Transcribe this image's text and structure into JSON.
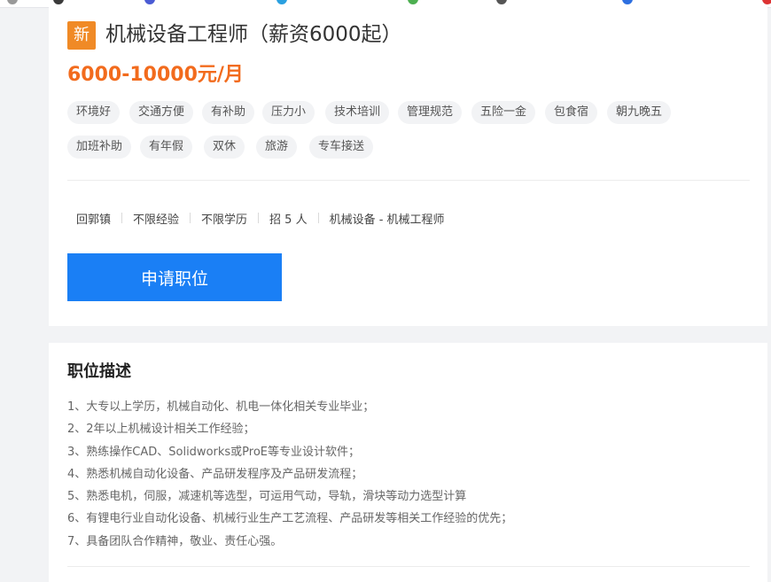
{
  "job": {
    "badge": "新",
    "title": "机械设备工程师（薪资6000起）",
    "salary": "6000-10000元/月",
    "tags_row1": [
      "环境好",
      "交通方便",
      "有补助",
      "压力小",
      "技术培训",
      "管理规范",
      "五险一金",
      "包食宿",
      "朝九晚五"
    ],
    "tags_row2": [
      "加班补助",
      "有年假",
      "双休",
      "旅游",
      "专车接送"
    ],
    "meta": {
      "location": "回郭镇",
      "experience": "不限经验",
      "education": "不限学历",
      "headcount": "招 5 人",
      "category": "机械设备 - 机械工程师"
    },
    "apply_label": "申请职位"
  },
  "description": {
    "title": "职位描述",
    "items": [
      "1、大专以上学历，机械自动化、机电一体化相关专业毕业；",
      "2、2年以上机械设计相关工作经验；",
      "3、熟练操作CAD、Solidworks或ProE等专业设计软件；",
      "4、熟悉机械自动化设备、产品研发程序及产品研发流程；",
      "5、熟悉电机，伺服，减速机等选型，可运用气动，导轨，滑块等动力选型计算",
      "6、有锂电行业自动化设备、机械行业生产工艺流程、产品研发等相关工作经验的优先；",
      "7、具备团队合作精神，敬业、责任心强。"
    ]
  },
  "colors": {
    "accent": "#1a7ff5",
    "salary": "#f26b1d",
    "badge": "#f08a26"
  }
}
